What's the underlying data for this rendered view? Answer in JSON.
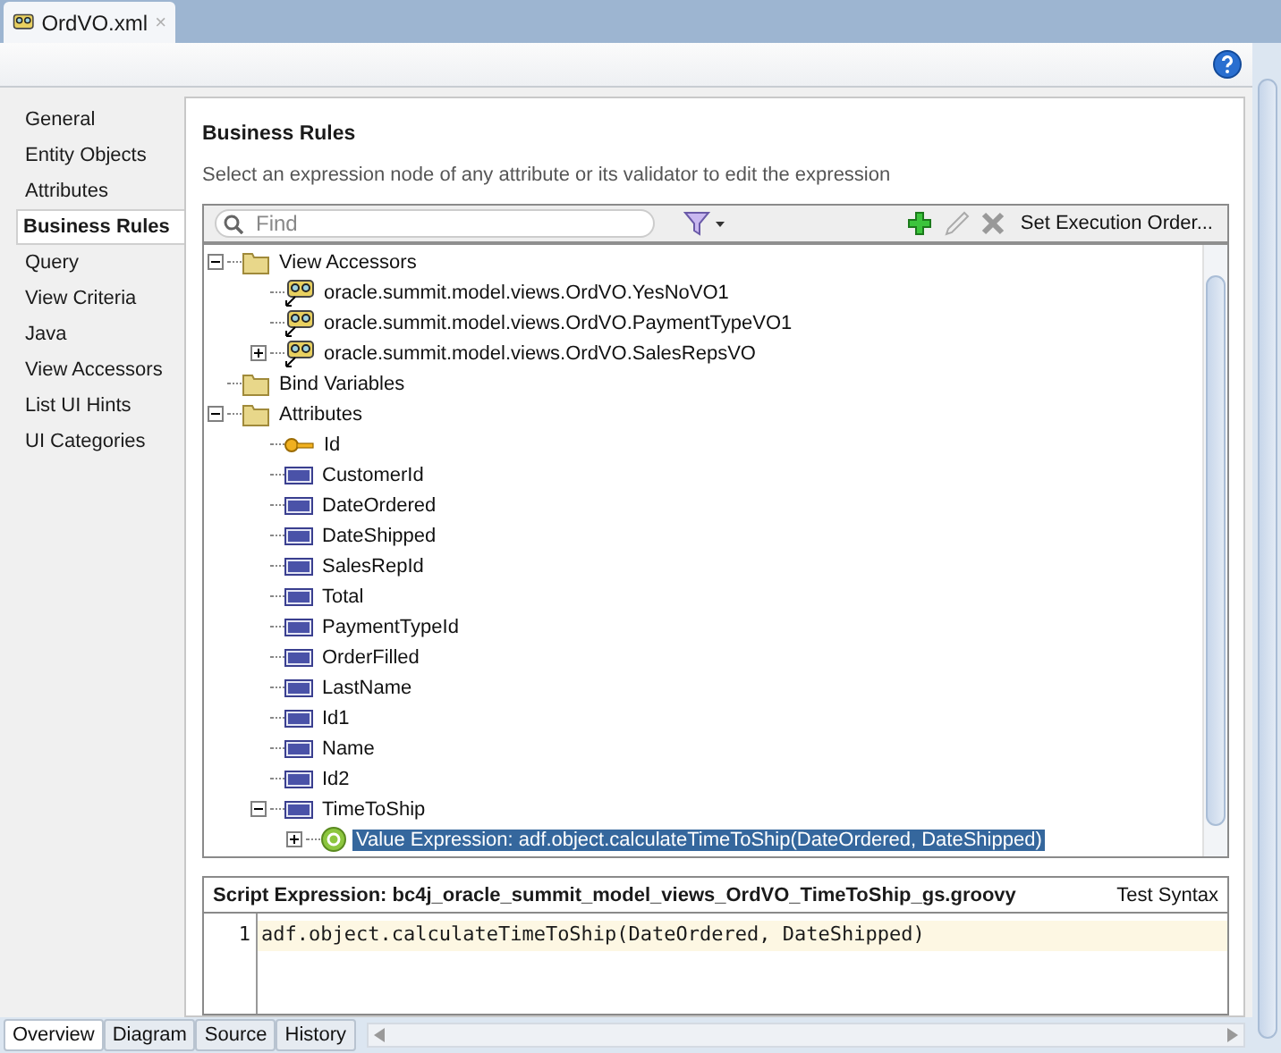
{
  "editor_tab": {
    "title": "OrdVO.xml",
    "close": "×"
  },
  "nav": [
    {
      "label": "General",
      "selected": false
    },
    {
      "label": "Entity Objects",
      "selected": false
    },
    {
      "label": "Attributes",
      "selected": false
    },
    {
      "label": "Business Rules",
      "selected": true
    },
    {
      "label": "Query",
      "selected": false
    },
    {
      "label": "View Criteria",
      "selected": false
    },
    {
      "label": "Java",
      "selected": false
    },
    {
      "label": "View Accessors",
      "selected": false
    },
    {
      "label": "List UI Hints",
      "selected": false
    },
    {
      "label": "UI Categories",
      "selected": false
    }
  ],
  "heading": "Business Rules",
  "instructions": "Select an expression node of any attribute or its validator to edit the expression",
  "search": {
    "placeholder": "Find"
  },
  "set_order_button": "Set Execution Order...",
  "tree": [
    {
      "label": "View Accessors",
      "kind": "folder",
      "expanded": true,
      "selected": false,
      "children": [
        {
          "label": "oracle.summit.model.views.OrdVO.YesNoVO1",
          "kind": "accessor",
          "selected": false
        },
        {
          "label": "oracle.summit.model.views.OrdVO.PaymentTypeVO1",
          "kind": "accessor",
          "selected": false
        },
        {
          "label": "oracle.summit.model.views.OrdVO.SalesRepsVO",
          "kind": "accessor",
          "expanded": false,
          "selected": false
        }
      ]
    },
    {
      "label": "Bind Variables",
      "kind": "folder",
      "selected": false
    },
    {
      "label": "Attributes",
      "kind": "folder",
      "expanded": true,
      "selected": false,
      "children": [
        {
          "label": "Id",
          "kind": "key",
          "selected": false
        },
        {
          "label": "CustomerId",
          "kind": "attribute",
          "selected": false
        },
        {
          "label": "DateOrdered",
          "kind": "attribute",
          "selected": false
        },
        {
          "label": "DateShipped",
          "kind": "attribute",
          "selected": false
        },
        {
          "label": "SalesRepId",
          "kind": "attribute",
          "selected": false
        },
        {
          "label": "Total",
          "kind": "attribute",
          "selected": false
        },
        {
          "label": "PaymentTypeId",
          "kind": "attribute",
          "selected": false
        },
        {
          "label": "OrderFilled",
          "kind": "attribute",
          "selected": false
        },
        {
          "label": "LastName",
          "kind": "attribute",
          "selected": false
        },
        {
          "label": "Id1",
          "kind": "attribute",
          "selected": false
        },
        {
          "label": "Name",
          "kind": "attribute",
          "selected": false
        },
        {
          "label": "Id2",
          "kind": "attribute",
          "selected": false
        },
        {
          "label": "TimeToShip",
          "kind": "attribute",
          "expanded": true,
          "selected": false,
          "children": [
            {
              "label": "Value Expression: adf.object.calculateTimeToShip(DateOrdered, DateShipped)",
              "kind": "expression",
              "expanded": false,
              "selected": true
            }
          ]
        }
      ]
    }
  ],
  "script": {
    "title": "Script Expression: bc4j_oracle_summit_model_views_OrdVO_TimeToShip_gs.groovy",
    "test_button": "Test Syntax",
    "lines": [
      {
        "number": "1",
        "code": "adf.object.calculateTimeToShip(DateOrdered, DateShipped)"
      }
    ]
  },
  "bottom_tabs": [
    {
      "label": "Overview",
      "selected": true
    },
    {
      "label": "Diagram",
      "selected": false
    },
    {
      "label": "Source",
      "selected": false
    },
    {
      "label": "History",
      "selected": false
    }
  ]
}
